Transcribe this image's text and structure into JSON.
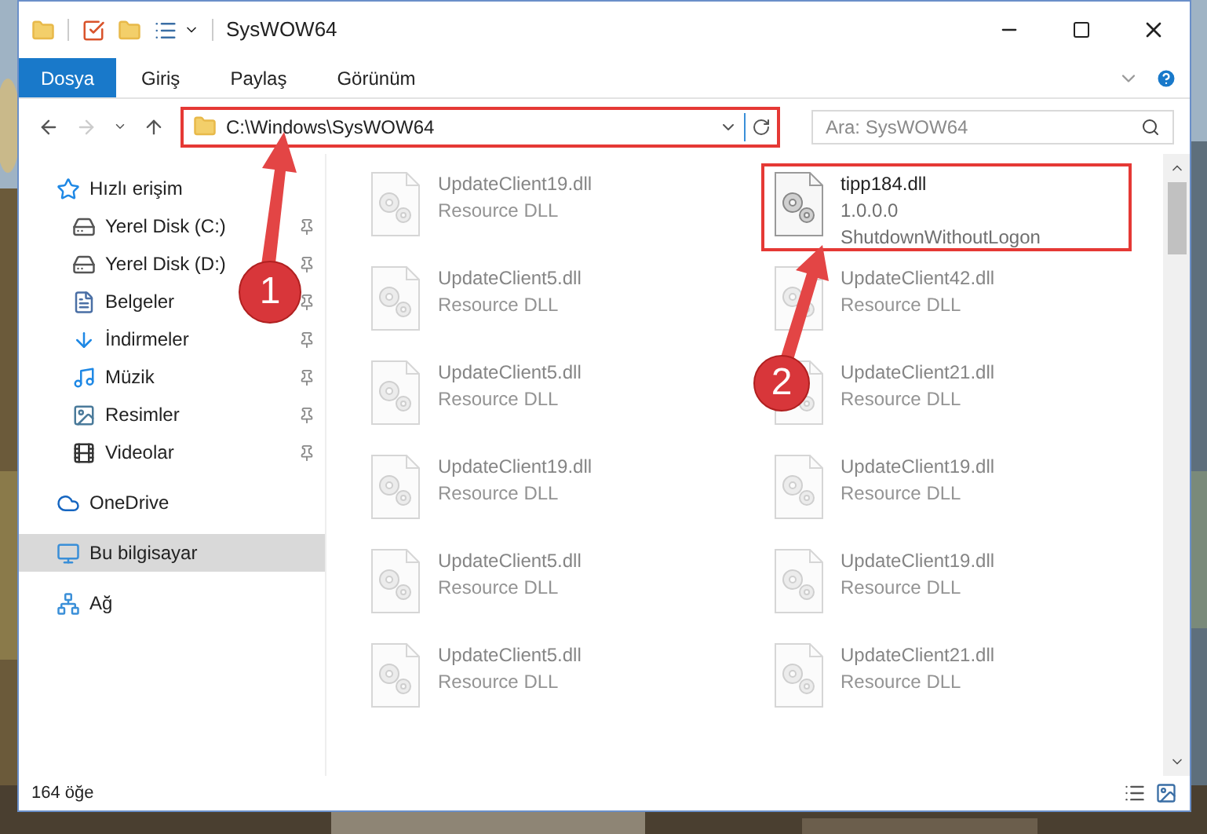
{
  "window": {
    "title": "SysWOW64"
  },
  "ribbon_tabs": [
    {
      "label": "Dosya",
      "kind": "file"
    },
    {
      "label": "Giriş",
      "kind": "tab"
    },
    {
      "label": "Paylaş",
      "kind": "tab"
    },
    {
      "label": "Görünüm",
      "kind": "tab"
    }
  ],
  "address_bar": {
    "path": "C:\\Windows\\SysWOW64",
    "highlighted": true
  },
  "search": {
    "placeholder": "Ara: SysWOW64"
  },
  "sidebar": {
    "items": [
      {
        "label": "Hızlı erişim",
        "kind": "quick",
        "selected": false,
        "children": [
          {
            "label": "Yerel Disk (C:)",
            "kind": "drive",
            "pinned": true
          },
          {
            "label": "Yerel Disk (D:)",
            "kind": "drive",
            "pinned": true
          },
          {
            "label": "Belgeler",
            "kind": "documents",
            "pinned": true
          },
          {
            "label": "İndirmeler",
            "kind": "downloads",
            "pinned": true
          },
          {
            "label": "Müzik",
            "kind": "music",
            "pinned": true
          },
          {
            "label": "Resimler",
            "kind": "pictures",
            "pinned": true
          },
          {
            "label": "Videolar",
            "kind": "videos",
            "pinned": true
          }
        ]
      },
      {
        "label": "OneDrive",
        "kind": "cloud",
        "selected": false
      },
      {
        "label": "Bu bilgisayar",
        "kind": "computer",
        "selected": true
      },
      {
        "label": "Ağ",
        "kind": "network",
        "selected": false
      }
    ]
  },
  "files": [
    {
      "name": "UpdateClient19.dll",
      "lines": [
        "Resource DLL"
      ],
      "highlighted": false,
      "faded": true
    },
    {
      "name": "tipp184.dll",
      "lines": [
        "1.0.0.0",
        "ShutdownWithoutLogon"
      ],
      "highlighted": true,
      "faded": false
    },
    {
      "name": "UpdateClient5.dll",
      "lines": [
        "Resource DLL"
      ],
      "highlighted": false,
      "faded": true
    },
    {
      "name": "UpdateClient42.dll",
      "lines": [
        "Resource DLL"
      ],
      "highlighted": false,
      "faded": true
    },
    {
      "name": "UpdateClient5.dll",
      "lines": [
        "Resource DLL"
      ],
      "highlighted": false,
      "faded": true
    },
    {
      "name": "UpdateClient21.dll",
      "lines": [
        "Resource DLL"
      ],
      "highlighted": false,
      "faded": true
    },
    {
      "name": "UpdateClient19.dll",
      "lines": [
        "Resource DLL"
      ],
      "highlighted": false,
      "faded": true
    },
    {
      "name": "UpdateClient19.dll",
      "lines": [
        "Resource DLL"
      ],
      "highlighted": false,
      "faded": true
    },
    {
      "name": "UpdateClient5.dll",
      "lines": [
        "Resource DLL"
      ],
      "highlighted": false,
      "faded": true
    },
    {
      "name": "UpdateClient19.dll",
      "lines": [
        "Resource DLL"
      ],
      "highlighted": false,
      "faded": true
    },
    {
      "name": "UpdateClient5.dll",
      "lines": [
        "Resource DLL"
      ],
      "highlighted": false,
      "faded": true
    },
    {
      "name": "UpdateClient21.dll",
      "lines": [
        "Resource DLL"
      ],
      "highlighted": false,
      "faded": true
    }
  ],
  "status_bar": {
    "count": "164 öğe"
  },
  "annotations": [
    {
      "number": "1"
    },
    {
      "number": "2"
    }
  ]
}
